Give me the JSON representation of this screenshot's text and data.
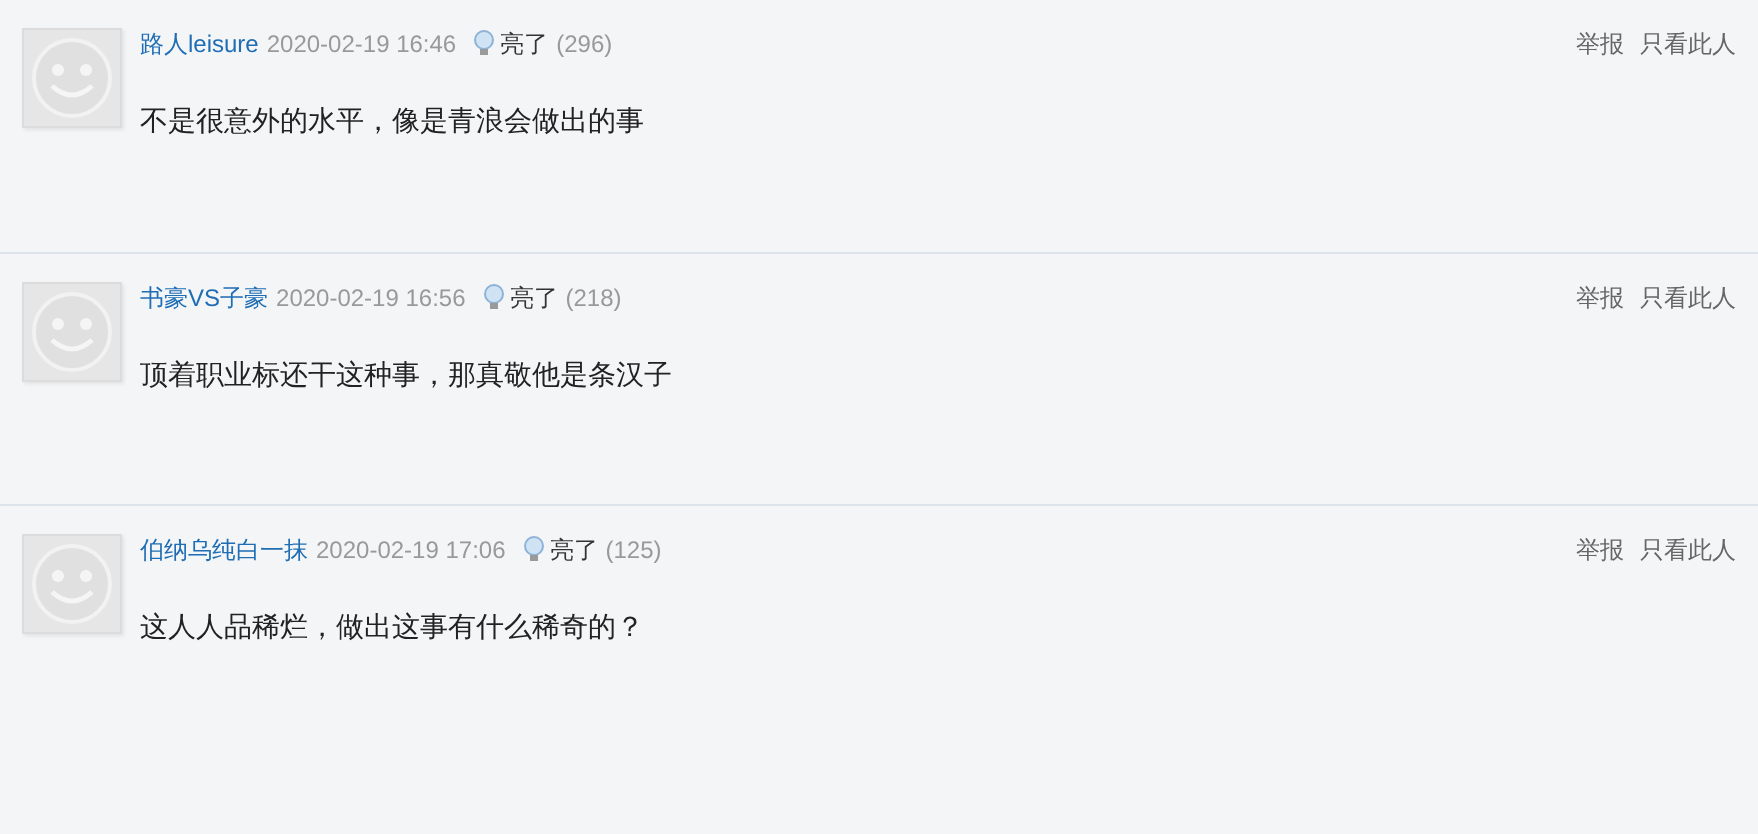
{
  "comments": [
    {
      "user": "路人leisure",
      "time": "2020-02-19 16:46",
      "like_label": "亮了",
      "like_count": "(296)",
      "text": "不是很意外的水平，像是青浪会做出的事",
      "actions": [
        "举报",
        "只看此人"
      ]
    },
    {
      "user": "书豪VS子豪",
      "time": "2020-02-19 16:56",
      "like_label": "亮了",
      "like_count": "(218)",
      "text": "顶着职业标还干这种事，那真敬他是条汉子",
      "actions": [
        "举报",
        "只看此人"
      ]
    },
    {
      "user": "伯纳乌纯白一抹",
      "time": "2020-02-19 17:06",
      "like_label": "亮了",
      "like_count": "(125)",
      "text": "这人人品稀烂，做出这事有什么稀奇的？",
      "actions": [
        "举报",
        "只看此人"
      ]
    }
  ]
}
